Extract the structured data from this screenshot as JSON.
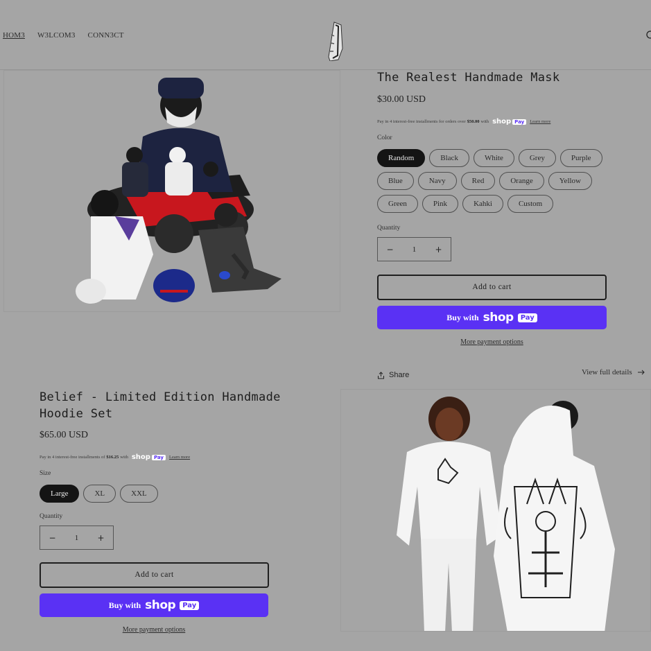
{
  "header": {
    "nav": [
      "HOM3",
      "W3LCOM3",
      "CONN3CT"
    ]
  },
  "product1": {
    "title": "The Realest Handmade Mask",
    "price": "$30.00 USD",
    "installments": {
      "prefix": "Pay in 4 interest-free installments for orders over",
      "amount": "$50.00",
      "with": "with",
      "learn": "Learn more"
    },
    "color_label": "Color",
    "colors": [
      "Random",
      "Black",
      "White",
      "Grey",
      "Purple",
      "Blue",
      "Navy",
      "Red",
      "Orange",
      "Yellow",
      "Green",
      "Pink",
      "Kahki",
      "Custom"
    ],
    "selected_color": "Random",
    "quantity_label": "Quantity",
    "quantity": "1",
    "add_to_cart": "Add to cart",
    "buy_with": "Buy with",
    "shop_word": "shop",
    "pay_word": "Pay",
    "more_payment": "More payment options",
    "share": "Share",
    "view_full": "View full details"
  },
  "product2": {
    "title": "Belief - Limited Edition Handmade Hoodie Set",
    "price": "$65.00 USD",
    "installments": {
      "prefix": "Pay in 4 interest-free installments of",
      "amount": "$16.25",
      "with": "with",
      "learn": "Learn more"
    },
    "size_label": "Size",
    "sizes": [
      "Large",
      "XL",
      "XXL"
    ],
    "selected_size": "Large",
    "quantity_label": "Quantity",
    "quantity": "1",
    "add_to_cart": "Add to cart",
    "buy_with": "Buy with",
    "shop_word": "shop",
    "pay_word": "Pay",
    "more_payment": "More payment options"
  },
  "icons": {
    "logo": "mask-logo-icon",
    "search": "search-icon",
    "share": "share-icon",
    "arrow": "arrow-right-icon",
    "minus": "minus-icon",
    "plus": "plus-icon"
  }
}
